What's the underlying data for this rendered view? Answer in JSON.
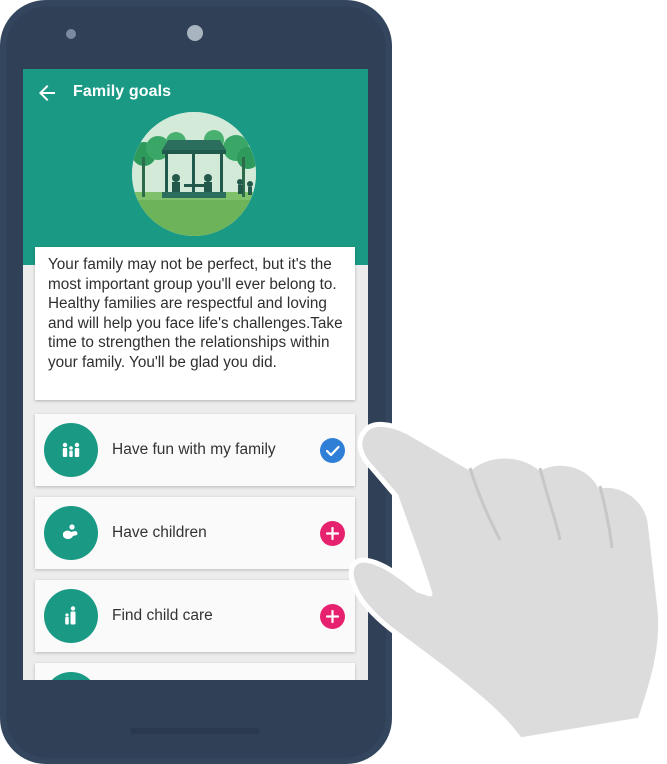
{
  "header": {
    "title": "Family goals"
  },
  "intro": {
    "text": "Your family may not be perfect, but it's the most important group you'll ever belong to. Healthy families are respectful and loving and will help you face life's challenges.Take time to strengthen the relationships within your family. You'll be glad you did."
  },
  "goals": [
    {
      "label": "Have fun with my family",
      "status": "added",
      "icon": "family-icon",
      "action_color": "#2f7fd6"
    },
    {
      "label": "Have children",
      "status": "not-added",
      "icon": "baby-icon",
      "action_color": "#e6226e"
    },
    {
      "label": "Find child care",
      "status": "not-added",
      "icon": "child-care-icon",
      "action_color": "#e6226e"
    }
  ],
  "colors": {
    "accent": "#1a9a85",
    "phone": "#34465e",
    "added": "#2f7fd6",
    "add": "#e6226e"
  }
}
